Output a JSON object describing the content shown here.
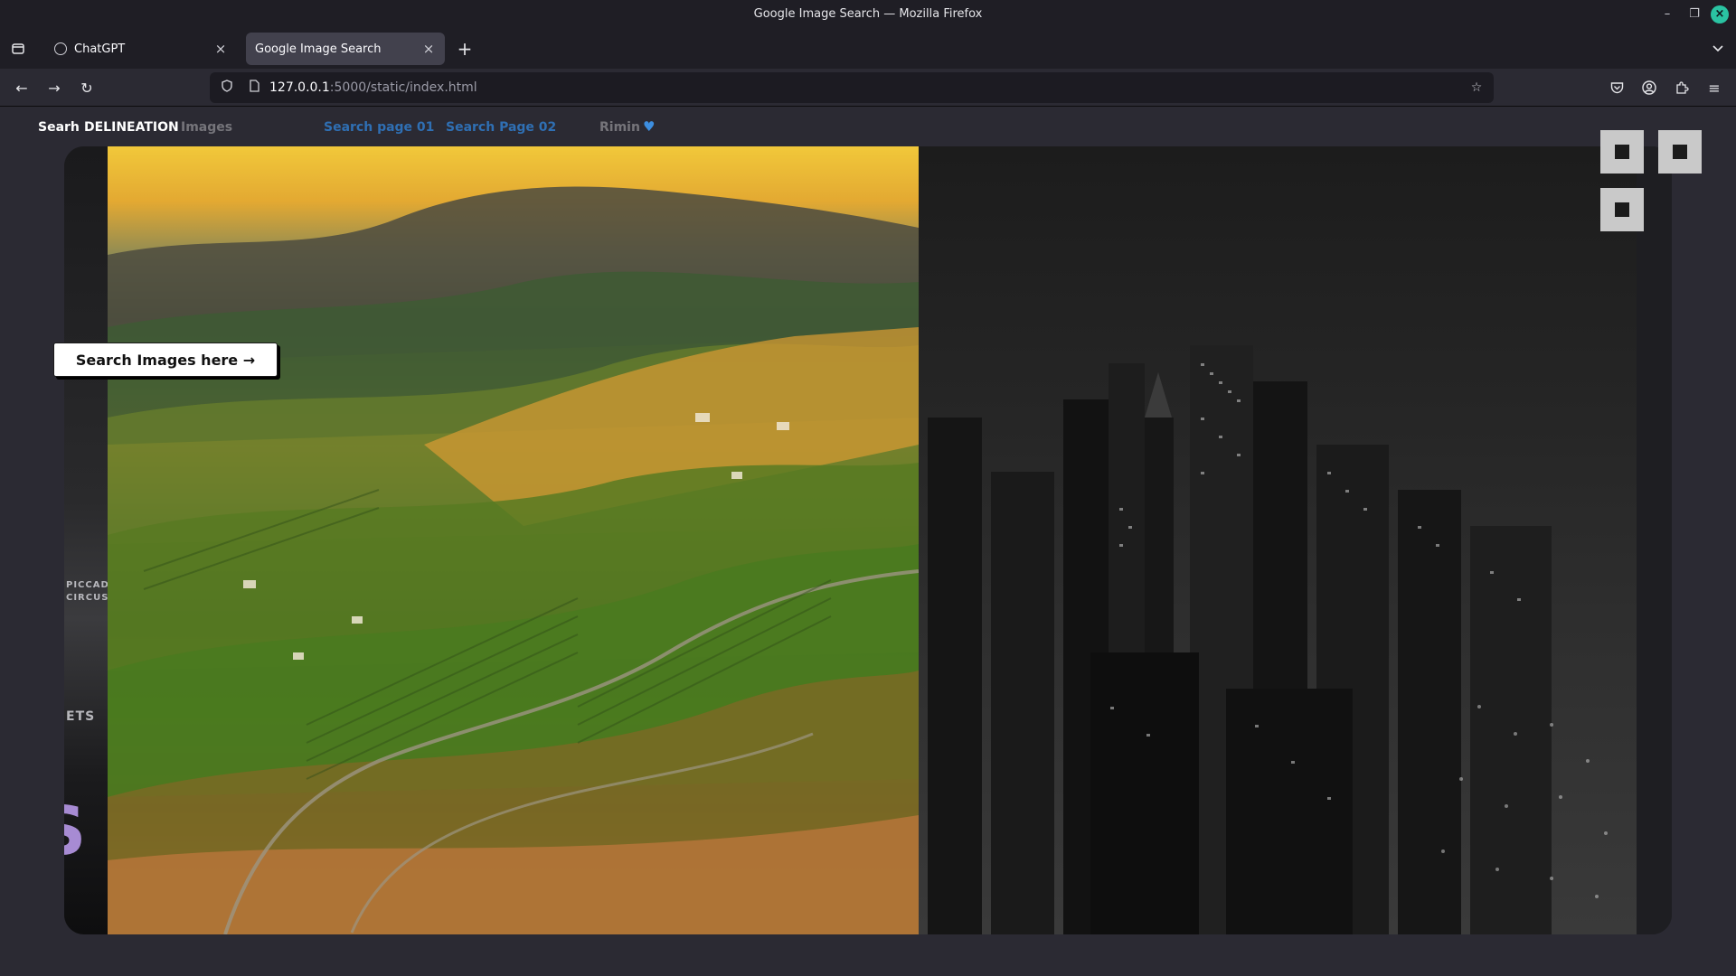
{
  "window": {
    "title": "Google Image Search — Mozilla Firefox"
  },
  "tabs": [
    {
      "label": "ChatGPT",
      "active": false
    },
    {
      "label": "Google Image Search",
      "active": true
    }
  ],
  "address_bar": {
    "host": "127.0.0.1",
    "path": ":5000/static/index.html"
  },
  "page_nav": {
    "brand": "Searh",
    "item_delineation": "DELINEATION",
    "item_faded": "Images",
    "search_page_1": "Search page 01",
    "search_page_2": "Search Page 02",
    "item_after": "Rimin"
  },
  "cta": {
    "label": "Search Images here →"
  },
  "hero_letter": "S",
  "strip_signs": [
    "PICCAD",
    "CIRCUS",
    "ETS"
  ],
  "colors": {
    "accent_blue": "#2f6fb3",
    "heart": "#3d8ee0",
    "letter": "#a78bd3"
  }
}
